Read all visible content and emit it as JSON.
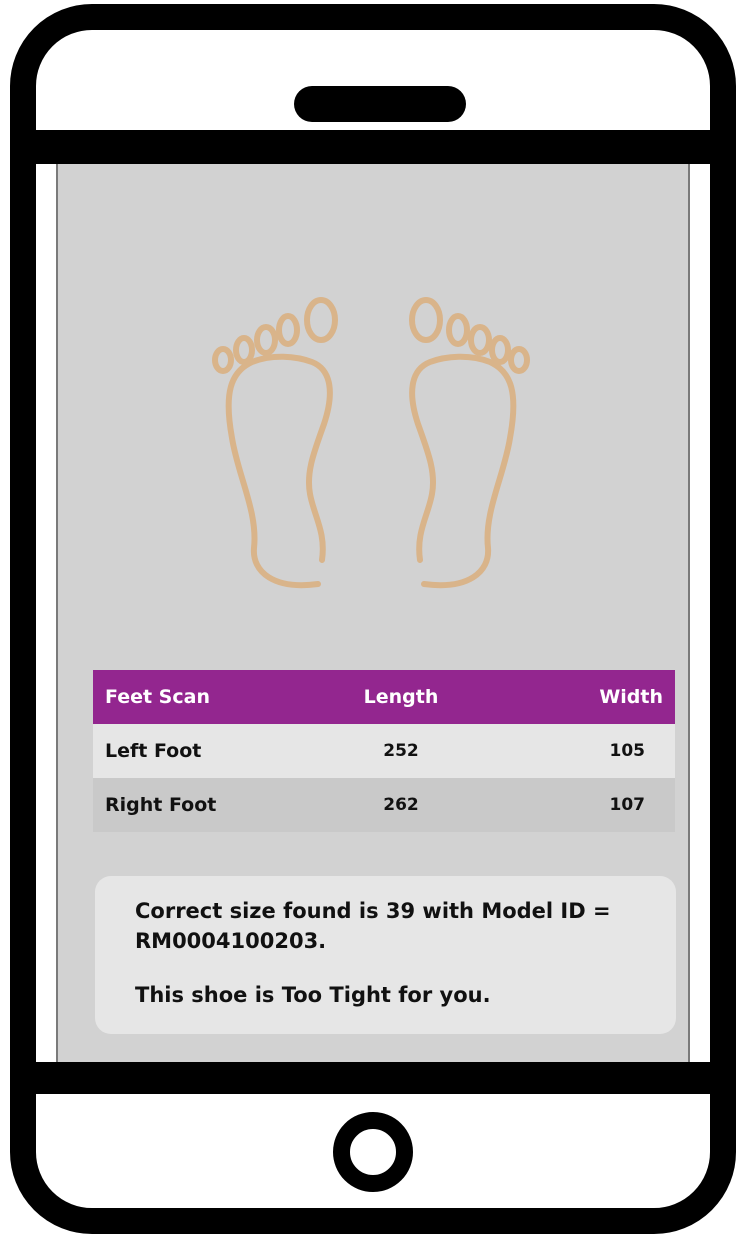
{
  "feet_table": {
    "headers": {
      "name": "Feet Scan",
      "length": "Length",
      "width": "Width"
    },
    "rows": [
      {
        "name": "Left Foot",
        "length": "252",
        "width": "105"
      },
      {
        "name": "Right Foot",
        "length": "262",
        "width": "107"
      }
    ]
  },
  "result": {
    "size_line": "Correct size found is  39 with Model ID = RM0004100203.",
    "fit_line": "This shoe is Too Tight for you."
  },
  "colors": {
    "header_purple": "#93268f",
    "foot_outline": "#d9b48a",
    "screen_gray": "#d2d2d2"
  },
  "icons": {
    "left_foot": "left-footprint-icon",
    "right_foot": "right-footprint-icon"
  }
}
